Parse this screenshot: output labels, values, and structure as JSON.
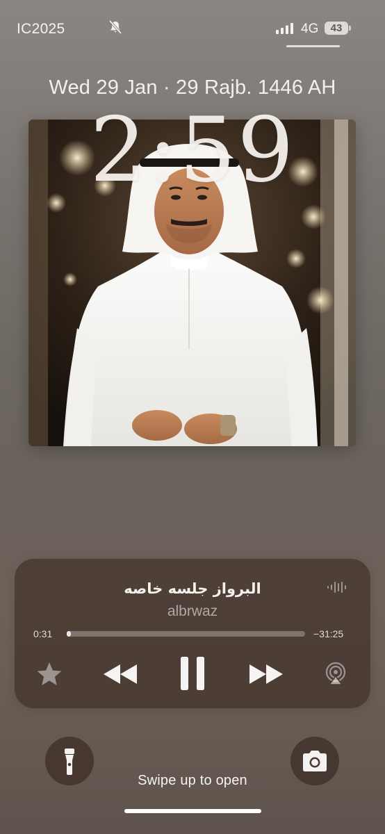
{
  "status_bar": {
    "carrier": "IC2025",
    "network": "4G",
    "battery_level": "43",
    "icons": [
      "mute-bell-icon",
      "cellular-signal-icon",
      "battery-icon"
    ]
  },
  "lock_screen": {
    "date": "Wed 29 Jan · 29 Rajb. 1446 AH",
    "time": "2:59",
    "swipe_hint": "Swipe up to open"
  },
  "now_playing": {
    "title": "البرواز جلسه خاصه",
    "artist": "albrwaz",
    "elapsed": "0:31",
    "remaining": "−31:25",
    "progress_fraction": 0.016,
    "icons": [
      "waveform-icon",
      "star-icon",
      "rewind-icon",
      "pause-icon",
      "fast-forward-icon",
      "airplay-icon"
    ]
  },
  "quick_actions": {
    "icons": [
      "flashlight-icon",
      "camera-icon"
    ]
  },
  "colors": {
    "widget_background": "#3a2a22",
    "text_primary": "#f4f1ee",
    "progress_fill": "#ffffff"
  }
}
